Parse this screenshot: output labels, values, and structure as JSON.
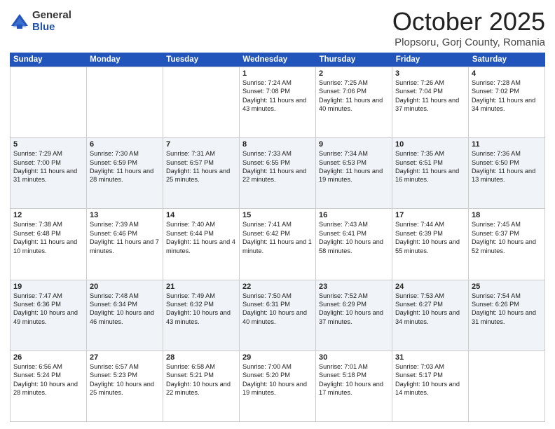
{
  "logo": {
    "general": "General",
    "blue": "Blue"
  },
  "title": "October 2025",
  "location": "Plopsoru, Gorj County, Romania",
  "header_days": [
    "Sunday",
    "Monday",
    "Tuesday",
    "Wednesday",
    "Thursday",
    "Friday",
    "Saturday"
  ],
  "weeks": [
    [
      {
        "day": "",
        "sunrise": "",
        "sunset": "",
        "daylight": ""
      },
      {
        "day": "",
        "sunrise": "",
        "sunset": "",
        "daylight": ""
      },
      {
        "day": "",
        "sunrise": "",
        "sunset": "",
        "daylight": ""
      },
      {
        "day": "1",
        "sunrise": "Sunrise: 7:24 AM",
        "sunset": "Sunset: 7:08 PM",
        "daylight": "Daylight: 11 hours and 43 minutes."
      },
      {
        "day": "2",
        "sunrise": "Sunrise: 7:25 AM",
        "sunset": "Sunset: 7:06 PM",
        "daylight": "Daylight: 11 hours and 40 minutes."
      },
      {
        "day": "3",
        "sunrise": "Sunrise: 7:26 AM",
        "sunset": "Sunset: 7:04 PM",
        "daylight": "Daylight: 11 hours and 37 minutes."
      },
      {
        "day": "4",
        "sunrise": "Sunrise: 7:28 AM",
        "sunset": "Sunset: 7:02 PM",
        "daylight": "Daylight: 11 hours and 34 minutes."
      }
    ],
    [
      {
        "day": "5",
        "sunrise": "Sunrise: 7:29 AM",
        "sunset": "Sunset: 7:00 PM",
        "daylight": "Daylight: 11 hours and 31 minutes."
      },
      {
        "day": "6",
        "sunrise": "Sunrise: 7:30 AM",
        "sunset": "Sunset: 6:59 PM",
        "daylight": "Daylight: 11 hours and 28 minutes."
      },
      {
        "day": "7",
        "sunrise": "Sunrise: 7:31 AM",
        "sunset": "Sunset: 6:57 PM",
        "daylight": "Daylight: 11 hours and 25 minutes."
      },
      {
        "day": "8",
        "sunrise": "Sunrise: 7:33 AM",
        "sunset": "Sunset: 6:55 PM",
        "daylight": "Daylight: 11 hours and 22 minutes."
      },
      {
        "day": "9",
        "sunrise": "Sunrise: 7:34 AM",
        "sunset": "Sunset: 6:53 PM",
        "daylight": "Daylight: 11 hours and 19 minutes."
      },
      {
        "day": "10",
        "sunrise": "Sunrise: 7:35 AM",
        "sunset": "Sunset: 6:51 PM",
        "daylight": "Daylight: 11 hours and 16 minutes."
      },
      {
        "day": "11",
        "sunrise": "Sunrise: 7:36 AM",
        "sunset": "Sunset: 6:50 PM",
        "daylight": "Daylight: 11 hours and 13 minutes."
      }
    ],
    [
      {
        "day": "12",
        "sunrise": "Sunrise: 7:38 AM",
        "sunset": "Sunset: 6:48 PM",
        "daylight": "Daylight: 11 hours and 10 minutes."
      },
      {
        "day": "13",
        "sunrise": "Sunrise: 7:39 AM",
        "sunset": "Sunset: 6:46 PM",
        "daylight": "Daylight: 11 hours and 7 minutes."
      },
      {
        "day": "14",
        "sunrise": "Sunrise: 7:40 AM",
        "sunset": "Sunset: 6:44 PM",
        "daylight": "Daylight: 11 hours and 4 minutes."
      },
      {
        "day": "15",
        "sunrise": "Sunrise: 7:41 AM",
        "sunset": "Sunset: 6:42 PM",
        "daylight": "Daylight: 11 hours and 1 minute."
      },
      {
        "day": "16",
        "sunrise": "Sunrise: 7:43 AM",
        "sunset": "Sunset: 6:41 PM",
        "daylight": "Daylight: 10 hours and 58 minutes."
      },
      {
        "day": "17",
        "sunrise": "Sunrise: 7:44 AM",
        "sunset": "Sunset: 6:39 PM",
        "daylight": "Daylight: 10 hours and 55 minutes."
      },
      {
        "day": "18",
        "sunrise": "Sunrise: 7:45 AM",
        "sunset": "Sunset: 6:37 PM",
        "daylight": "Daylight: 10 hours and 52 minutes."
      }
    ],
    [
      {
        "day": "19",
        "sunrise": "Sunrise: 7:47 AM",
        "sunset": "Sunset: 6:36 PM",
        "daylight": "Daylight: 10 hours and 49 minutes."
      },
      {
        "day": "20",
        "sunrise": "Sunrise: 7:48 AM",
        "sunset": "Sunset: 6:34 PM",
        "daylight": "Daylight: 10 hours and 46 minutes."
      },
      {
        "day": "21",
        "sunrise": "Sunrise: 7:49 AM",
        "sunset": "Sunset: 6:32 PM",
        "daylight": "Daylight: 10 hours and 43 minutes."
      },
      {
        "day": "22",
        "sunrise": "Sunrise: 7:50 AM",
        "sunset": "Sunset: 6:31 PM",
        "daylight": "Daylight: 10 hours and 40 minutes."
      },
      {
        "day": "23",
        "sunrise": "Sunrise: 7:52 AM",
        "sunset": "Sunset: 6:29 PM",
        "daylight": "Daylight: 10 hours and 37 minutes."
      },
      {
        "day": "24",
        "sunrise": "Sunrise: 7:53 AM",
        "sunset": "Sunset: 6:27 PM",
        "daylight": "Daylight: 10 hours and 34 minutes."
      },
      {
        "day": "25",
        "sunrise": "Sunrise: 7:54 AM",
        "sunset": "Sunset: 6:26 PM",
        "daylight": "Daylight: 10 hours and 31 minutes."
      }
    ],
    [
      {
        "day": "26",
        "sunrise": "Sunrise: 6:56 AM",
        "sunset": "Sunset: 5:24 PM",
        "daylight": "Daylight: 10 hours and 28 minutes."
      },
      {
        "day": "27",
        "sunrise": "Sunrise: 6:57 AM",
        "sunset": "Sunset: 5:23 PM",
        "daylight": "Daylight: 10 hours and 25 minutes."
      },
      {
        "day": "28",
        "sunrise": "Sunrise: 6:58 AM",
        "sunset": "Sunset: 5:21 PM",
        "daylight": "Daylight: 10 hours and 22 minutes."
      },
      {
        "day": "29",
        "sunrise": "Sunrise: 7:00 AM",
        "sunset": "Sunset: 5:20 PM",
        "daylight": "Daylight: 10 hours and 19 minutes."
      },
      {
        "day": "30",
        "sunrise": "Sunrise: 7:01 AM",
        "sunset": "Sunset: 5:18 PM",
        "daylight": "Daylight: 10 hours and 17 minutes."
      },
      {
        "day": "31",
        "sunrise": "Sunrise: 7:03 AM",
        "sunset": "Sunset: 5:17 PM",
        "daylight": "Daylight: 10 hours and 14 minutes."
      },
      {
        "day": "",
        "sunrise": "",
        "sunset": "",
        "daylight": ""
      }
    ]
  ]
}
